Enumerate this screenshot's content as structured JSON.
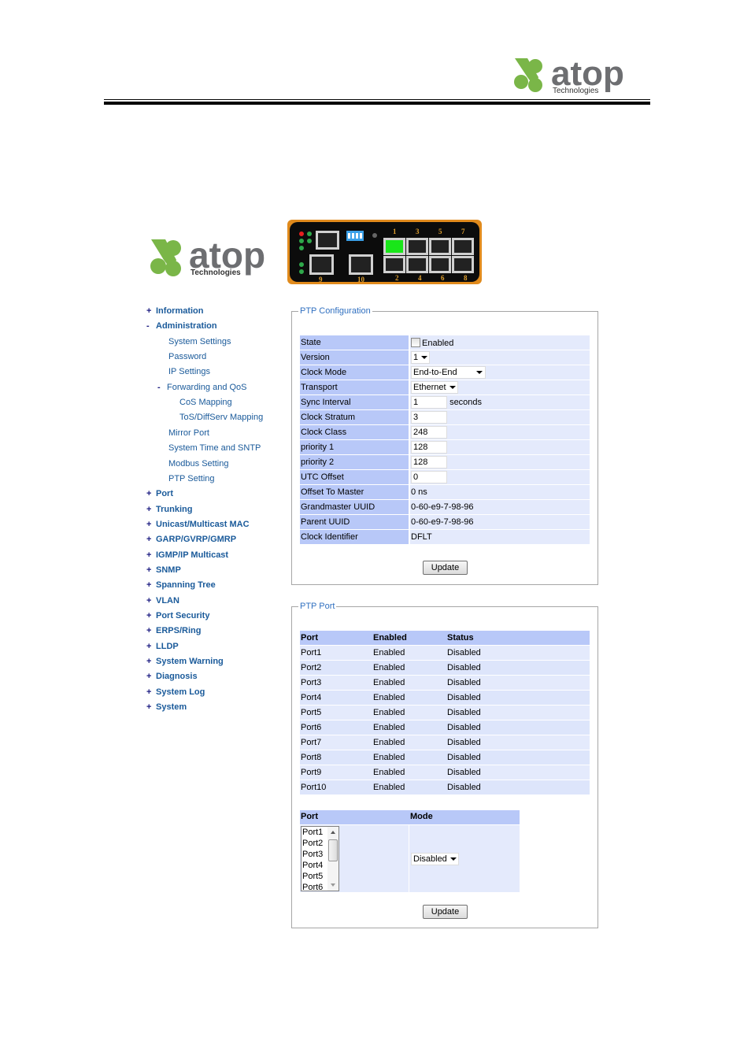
{
  "header": {
    "logo_text": "atop",
    "logo_subtext": "Technologies"
  },
  "app": {
    "logo_text": "atop",
    "logo_subtext": "Technologies",
    "device": {
      "port_labels_top": [
        "1",
        "3",
        "5",
        "7"
      ],
      "port_labels_bottom": [
        "2",
        "4",
        "6",
        "8"
      ],
      "uplink_labels": [
        "9",
        "10"
      ],
      "active_port": "1"
    }
  },
  "colors": {
    "brand_green": "#7ab648",
    "brand_gray": "#6d6e71",
    "nav_link": "#1a5a9a",
    "legend": "#3070c0",
    "label_bg": "#b8c8f8",
    "value_bg": "#e4eafc",
    "port_active": "#19e619",
    "device_frame": "#e08a1c"
  },
  "sidebar": {
    "items": [
      {
        "sign": "+",
        "label": "Information",
        "level": 0
      },
      {
        "sign": "-",
        "label": "Administration",
        "level": 0
      },
      {
        "sign": "",
        "label": "System Settings",
        "level": 1
      },
      {
        "sign": "",
        "label": "Password",
        "level": 1
      },
      {
        "sign": "",
        "label": "IP Settings",
        "level": 1
      },
      {
        "sign": "-",
        "label": "Forwarding and QoS",
        "level": 1
      },
      {
        "sign": "",
        "label": "CoS Mapping",
        "level": 2
      },
      {
        "sign": "",
        "label": "ToS/DiffServ Mapping",
        "level": 2
      },
      {
        "sign": "",
        "label": "Mirror Port",
        "level": 1
      },
      {
        "sign": "",
        "label": "System Time and SNTP",
        "level": 1
      },
      {
        "sign": "",
        "label": "Modbus Setting",
        "level": 1
      },
      {
        "sign": "",
        "label": "PTP Setting",
        "level": 1
      },
      {
        "sign": "+",
        "label": "Port",
        "level": 0
      },
      {
        "sign": "+",
        "label": "Trunking",
        "level": 0
      },
      {
        "sign": "+",
        "label": "Unicast/Multicast MAC",
        "level": 0
      },
      {
        "sign": "+",
        "label": "GARP/GVRP/GMRP",
        "level": 0
      },
      {
        "sign": "+",
        "label": "IGMP/IP Multicast",
        "level": 0
      },
      {
        "sign": "+",
        "label": "SNMP",
        "level": 0
      },
      {
        "sign": "+",
        "label": "Spanning Tree",
        "level": 0
      },
      {
        "sign": "+",
        "label": "VLAN",
        "level": 0
      },
      {
        "sign": "+",
        "label": "Port Security",
        "level": 0
      },
      {
        "sign": "+",
        "label": "ERPS/Ring",
        "level": 0
      },
      {
        "sign": "+",
        "label": "LLDP",
        "level": 0
      },
      {
        "sign": "+",
        "label": "System Warning",
        "level": 0
      },
      {
        "sign": "+",
        "label": "Diagnosis",
        "level": 0
      },
      {
        "sign": "+",
        "label": "System Log",
        "level": 0
      },
      {
        "sign": "+",
        "label": "System",
        "level": 0
      }
    ]
  },
  "ptp_config": {
    "legend": "PTP Configuration",
    "state": {
      "label": "State",
      "checkbox_label": "Enabled",
      "checked": false
    },
    "version": {
      "label": "Version",
      "value": "1"
    },
    "clock_mode": {
      "label": "Clock Mode",
      "value": "End-to-End"
    },
    "transport": {
      "label": "Transport",
      "value": "Ethernet"
    },
    "sync_interval": {
      "label": "Sync Interval",
      "value": "1",
      "unit": "seconds"
    },
    "clock_stratum": {
      "label": "Clock Stratum",
      "value": "3"
    },
    "clock_class": {
      "label": "Clock Class",
      "value": "248"
    },
    "priority1": {
      "label": "priority 1",
      "value": "128"
    },
    "priority2": {
      "label": "priority 2",
      "value": "128"
    },
    "utc_offset": {
      "label": "UTC Offset",
      "value": "0"
    },
    "offset_to_master": {
      "label": "Offset To Master",
      "value": "0 ns"
    },
    "grandmaster_uuid": {
      "label": "Grandmaster UUID",
      "value": "0-60-e9-7-98-96"
    },
    "parent_uuid": {
      "label": "Parent UUID",
      "value": "0-60-e9-7-98-96"
    },
    "clock_identifier": {
      "label": "Clock Identifier",
      "value": "DFLT"
    },
    "update_label": "Update"
  },
  "ptp_port": {
    "legend": "PTP Port",
    "columns": [
      "Port",
      "Enabled",
      "Status"
    ],
    "rows": [
      [
        "Port1",
        "Enabled",
        "Disabled"
      ],
      [
        "Port2",
        "Enabled",
        "Disabled"
      ],
      [
        "Port3",
        "Enabled",
        "Disabled"
      ],
      [
        "Port4",
        "Enabled",
        "Disabled"
      ],
      [
        "Port5",
        "Enabled",
        "Disabled"
      ],
      [
        "Port6",
        "Enabled",
        "Disabled"
      ],
      [
        "Port7",
        "Enabled",
        "Disabled"
      ],
      [
        "Port8",
        "Enabled",
        "Disabled"
      ],
      [
        "Port9",
        "Enabled",
        "Disabled"
      ],
      [
        "Port10",
        "Enabled",
        "Disabled"
      ]
    ],
    "mode_columns": [
      "Port",
      "Mode"
    ],
    "port_list": [
      "Port1",
      "Port2",
      "Port3",
      "Port4",
      "Port5",
      "Port6"
    ],
    "mode_value": "Disabled",
    "update_label": "Update"
  }
}
